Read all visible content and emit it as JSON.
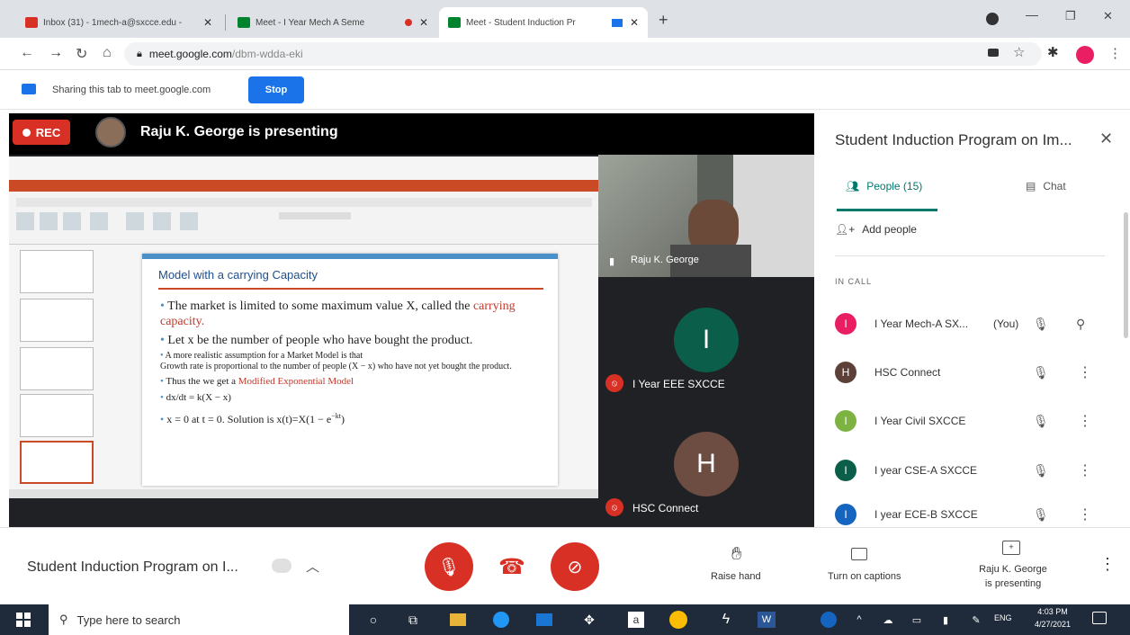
{
  "browser": {
    "tabs": [
      {
        "label": "Inbox (31) - 1mech-a@sxcce.edu - ",
        "icon": "gmail-icon",
        "active": false
      },
      {
        "label": "Meet - I Year Mech A Seme",
        "icon": "meet-icon",
        "active": false
      },
      {
        "label": "Meet - Student Induction Pr",
        "icon": "meet-icon",
        "active": true
      }
    ],
    "url_domain": "meet.google.com",
    "url_path": "/dbm-wdda-eki",
    "share_text": "Sharing this tab to meet.google.com",
    "stop_label": "Stop"
  },
  "meet": {
    "rec_label": "REC",
    "presenter_banner": "Raju K. George is presenting",
    "slide": {
      "title": "Model with a carrying Capacity",
      "lines": [
        {
          "pre": "The market is limited to some maximum value X, called the ",
          "red": "carrying capacity."
        },
        {
          "pre": "Let x be  the number of people who have bought the product.",
          "red": ""
        },
        {
          "pre": "A more realistic assumption for a Market Model is that",
          "red": ""
        },
        {
          "pre": "Growth rate is proportional to the number of people (X − x) who have not yet bought the product.",
          "red": ""
        },
        {
          "pre": "Thus the  we get a ",
          "red": "Modified Exponential Model"
        },
        {
          "pre": "dx/dt = k(X − x)",
          "red": ""
        },
        {
          "pre": "x = 0 at t = 0. Solution is    x(t)=X(1 − e",
          "red": ""
        }
      ],
      "exponent": "−kt"
    },
    "tiles": [
      {
        "name": "Raju K. George",
        "muted": false
      },
      {
        "name": "I Year EEE SXCCE",
        "initial": "I",
        "color": "#0b5f4a",
        "muted": true
      },
      {
        "name": "HSC Connect",
        "initial": "H",
        "color": "#6d4c41",
        "muted": true
      }
    ],
    "panel": {
      "title": "Student Induction Program on Im...",
      "people_tab": "People (15)",
      "chat_tab": "Chat",
      "add_people": "Add people",
      "section": "IN CALL",
      "people": [
        {
          "initial": "I",
          "name": "I Year Mech-A SX...",
          "you": "(You)",
          "color": "#e91e63"
        },
        {
          "initial": "H",
          "name": "HSC Connect",
          "you": "",
          "color": "#5d4037"
        },
        {
          "initial": "I",
          "name": "I Year Civil SXCCE",
          "you": "",
          "color": "#7cb342"
        },
        {
          "initial": "I",
          "name": "I year CSE-A SXCCE",
          "you": "",
          "color": "#0b5f4a"
        },
        {
          "initial": "I",
          "name": "I year ECE-B SXCCE",
          "you": "",
          "color": "#1565c0"
        }
      ]
    },
    "bottom": {
      "meeting_name": "Student Induction Program on I...",
      "raise_hand": "Raise hand",
      "captions": "Turn on captions",
      "presenting_line1": "Raju K. George",
      "presenting_line2": "is presenting"
    }
  },
  "taskbar": {
    "search_placeholder": "Type here to search",
    "lang": "ENG",
    "time": "4:03 PM",
    "date": "4/27/2021"
  }
}
